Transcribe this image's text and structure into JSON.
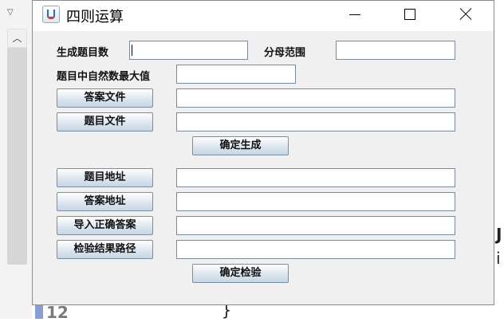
{
  "window": {
    "title": "四则运算"
  },
  "form": {
    "count_label": "生成题目数",
    "count_value": "",
    "denominator_label": "分母范围",
    "denominator_value": "",
    "max_natural_label": "题目中自然数最大值",
    "max_natural_value": "",
    "answer_file_button": "答案文件",
    "answer_file_value": "",
    "exercise_file_button": "题目文件",
    "exercise_file_value": "",
    "generate_button": "确定生成",
    "exercise_path_button": "题目地址",
    "exercise_path_value": "",
    "answer_path_button": "答案地址",
    "answer_path_value": "",
    "import_answer_button": "导入正确答案",
    "import_answer_value": "",
    "result_path_button": "检验结果路径",
    "result_path_value": "",
    "check_button": "确定检验"
  },
  "background": {
    "line_number": "12",
    "brace": "}",
    "right_char_1": "J",
    "right_char_2": "i"
  },
  "icons": {
    "app": "java-cup-icon",
    "scroll_up": "chevron-up-icon",
    "dropdown": "triangle-down-icon"
  }
}
